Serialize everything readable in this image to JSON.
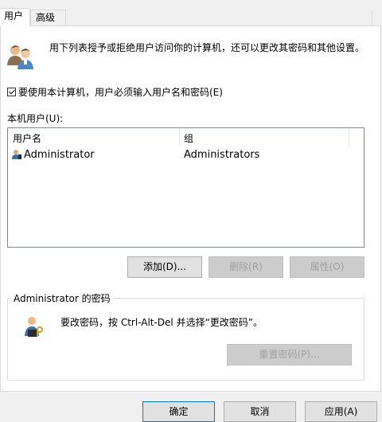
{
  "tabs": [
    {
      "label": "用户"
    },
    {
      "label": "高级"
    }
  ],
  "description": "用下列表授予或拒绝用户访问你的计算机，还可以更改其密码和其他设置。",
  "must_login_checkbox": {
    "label": "要使用本计算机，用户必须输入用户名和密码(E)",
    "checked": true
  },
  "users_section_label": "本机用户(U):",
  "listview": {
    "columns": [
      "用户名",
      "组"
    ],
    "rows": [
      {
        "username": "Administrator",
        "group": "Administrators"
      }
    ]
  },
  "buttons": {
    "add": "添加(D)...",
    "remove": "删除(R)",
    "properties": "属性(O)"
  },
  "password_group": {
    "title": "Administrator 的密码",
    "text": "要改密码，按 Ctrl-Alt-Del 并选择“更改密码”。",
    "reset_button": "重置密码(P)..."
  },
  "footer": {
    "ok": "确定",
    "cancel": "取消",
    "apply": "应用(A)"
  },
  "colors": {
    "accent": "#0078d7",
    "panel": "#ffffff",
    "chrome": "#f0f0f0"
  }
}
